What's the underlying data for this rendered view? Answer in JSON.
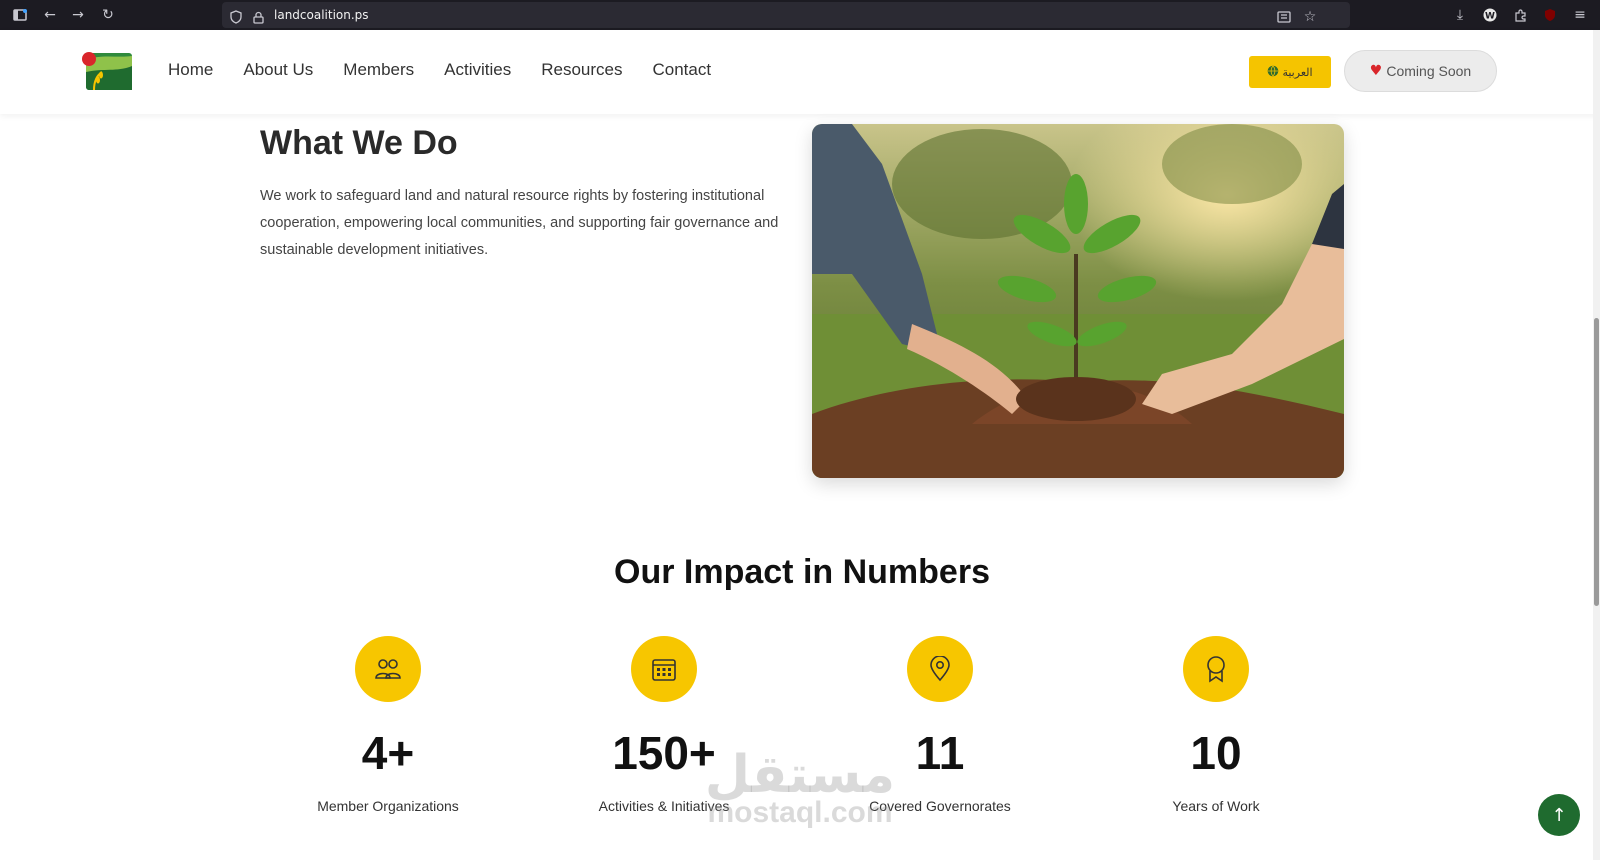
{
  "browser": {
    "url": "landcoalition.ps"
  },
  "nav": {
    "items": [
      "Home",
      "About Us",
      "Members",
      "Activities",
      "Resources",
      "Contact"
    ],
    "lang_label": "العربية",
    "coming_soon_label": "Coming Soon"
  },
  "what_we_do": {
    "title": "What We Do",
    "text": "We work to safeguard land and natural resource rights by fostering institutional cooperation, empowering local communities, and supporting fair governance and sustainable development initiatives.",
    "image": "seedling-planting-photo"
  },
  "impact": {
    "title": "Our Impact in Numbers",
    "stats": [
      {
        "value": "4+",
        "label": "Member Organizations",
        "icon": "people-icon"
      },
      {
        "value": "150+",
        "label": "Activities & Initiatives",
        "icon": "calendar-icon"
      },
      {
        "value": "11",
        "label": "Covered Governorates",
        "icon": "location-pin-icon"
      },
      {
        "value": "10",
        "label": "Years of Work",
        "icon": "award-icon"
      }
    ]
  },
  "watermark": {
    "arabic": "مستقل",
    "latin": "mostaql.com"
  },
  "colors": {
    "accent_yellow": "#f7c600",
    "brand_green": "#1f6b2f",
    "heart_red": "#d9262b",
    "browser_bar": "#1c1b22"
  }
}
